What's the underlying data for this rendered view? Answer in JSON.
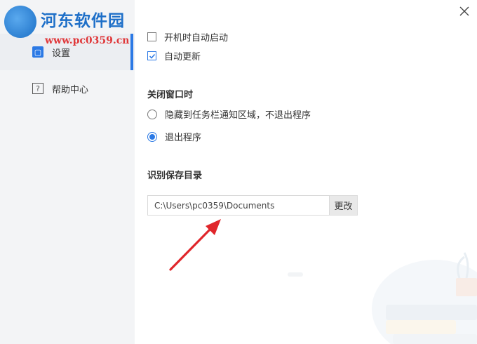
{
  "watermark": {
    "title": "河东软件园",
    "url": "www.pc0359.cn"
  },
  "sidebar": {
    "items": [
      {
        "label": "设置",
        "icon": "settings-icon",
        "active": true
      },
      {
        "label": "帮助中心",
        "icon": "help-icon",
        "active": false
      }
    ]
  },
  "startup": {
    "autostart_label": "开机时自动启动",
    "autostart_checked": false,
    "autoupdate_label": "自动更新",
    "autoupdate_checked": true
  },
  "close_window": {
    "title": "关闭窗口时",
    "option_hide_label": "隐藏到任务栏通知区域，不退出程序",
    "option_exit_label": "退出程序",
    "selected": "exit"
  },
  "save_dir": {
    "title": "识别保存目录",
    "path": "C:\\Users\\pc0359\\Documents",
    "change_label": "更改"
  },
  "colors": {
    "accent": "#2b79e5",
    "sidebar_bg": "#f3f4f6",
    "annotation_arrow": "#e0262b"
  }
}
